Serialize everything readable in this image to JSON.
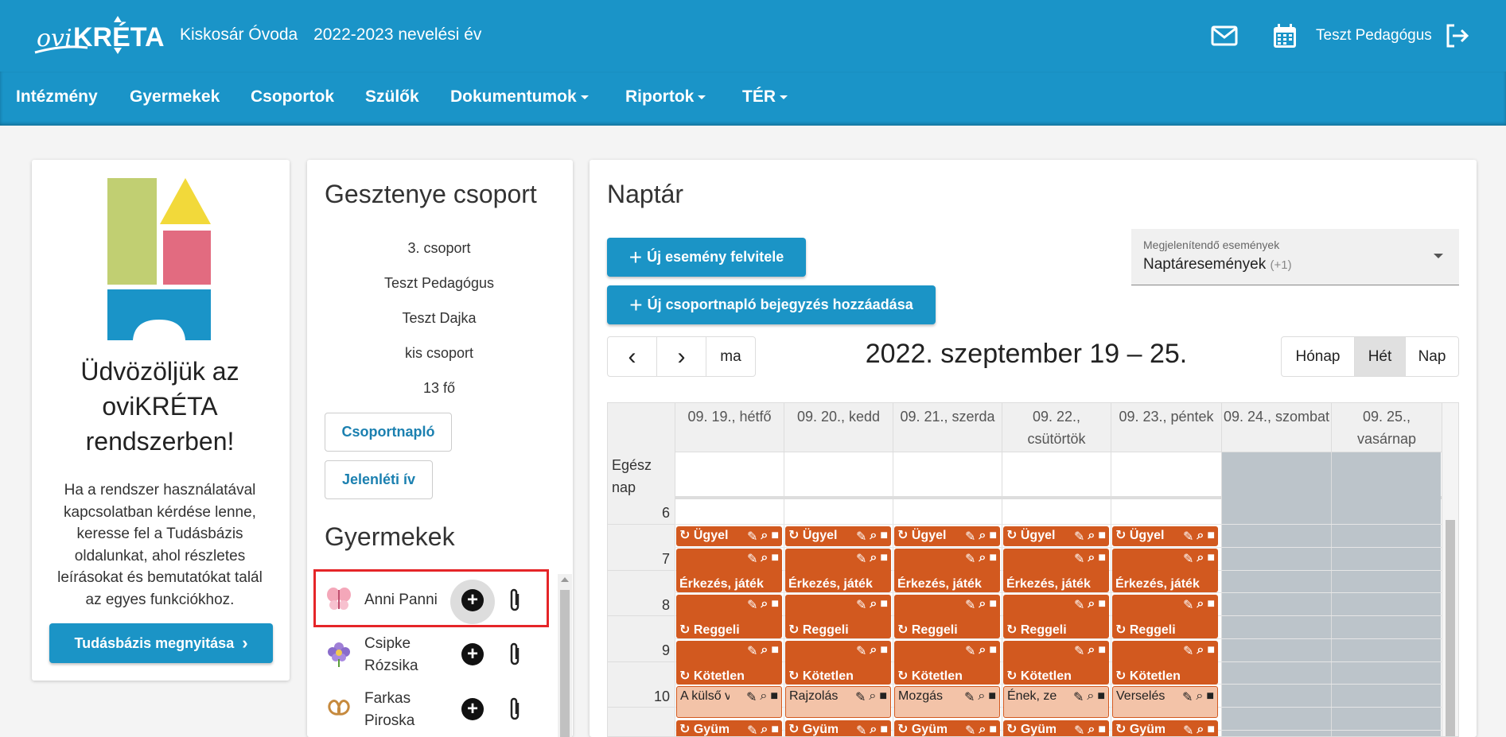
{
  "header": {
    "logo_text": "oviKRÉTA",
    "institution": "Kiskosár Óvoda",
    "school_year": "2022-2023 nevelési év",
    "user_name": "Teszt Pedagógus"
  },
  "nav": [
    {
      "label": "Intézmény"
    },
    {
      "label": "Gyermekek"
    },
    {
      "label": "Csoportok"
    },
    {
      "label": "Szülők"
    },
    {
      "label": "Dokumentumok"
    },
    {
      "label": "Riportok"
    },
    {
      "label": "TÉR"
    }
  ],
  "welcome": {
    "title": "Üdvözöljük az oviKRÉTA rendszerben!",
    "text": "Ha a rendszer használatával kapcsolatban kérdése lenne, keresse fel a Tudásbázis oldalunkat, ahol részletes leírásokat és bemutatókat talál az egyes funkciókhoz.",
    "button": "Tudásbázis megnyitása"
  },
  "group": {
    "title": "Gesztenye csoport",
    "details": [
      "3. csoport",
      "Teszt Pedagógus",
      "Teszt Dajka",
      "kis csoport",
      "13 fő"
    ],
    "btn_diary": "Csoportnapló",
    "btn_attendance": "Jelenléti ív",
    "children_title": "Gyermekek",
    "children": [
      {
        "name": "Anni Panni",
        "icon": "butterfly-icon"
      },
      {
        "name": "Csipke Rózsika",
        "icon": "flower-icon"
      },
      {
        "name": "Farkas Piroska",
        "icon": "pretzel-icon"
      }
    ]
  },
  "calendar": {
    "title": "Naptár",
    "btn_new_event": "Új esemény felvitele",
    "btn_new_diary": "Új csoportnapló bejegyzés hozzáadása",
    "select_label": "Megjelenítendő események",
    "select_value": "Naptáresemények",
    "select_extra": "(+1)",
    "today": "ma",
    "range": "2022. szeptember 19 – 25.",
    "views": [
      "Hónap",
      "Hét",
      "Nap"
    ],
    "active_view": "Hét",
    "all_day": "Egész nap",
    "days": [
      {
        "label": "09. 19., hétfő"
      },
      {
        "label": "09. 20., kedd"
      },
      {
        "label": "09. 21., szerda"
      },
      {
        "label": "09. 22., csütörtök"
      },
      {
        "label": "09. 23., péntek"
      },
      {
        "label": "09. 24., szombat"
      },
      {
        "label": "09. 25., vasárnap"
      }
    ],
    "hours": [
      "6",
      "7",
      "8",
      "9",
      "10"
    ],
    "events": {
      "ugyelet": "Ügyelet",
      "erkezes": "Érkezés, játék",
      "reggeli": "Reggeli",
      "kotetlen": "Kötetlen",
      "gyumolcs": "Gyümölcs",
      "activities": [
        "A külső világ",
        "Rajzolás",
        "Mozgás",
        "Ének, zene",
        "Verselés"
      ]
    }
  },
  "colors": {
    "brand": "#1a94c8",
    "event": "#d2591f",
    "event_light": "#f3c3a8",
    "highlight": "#e52528"
  }
}
